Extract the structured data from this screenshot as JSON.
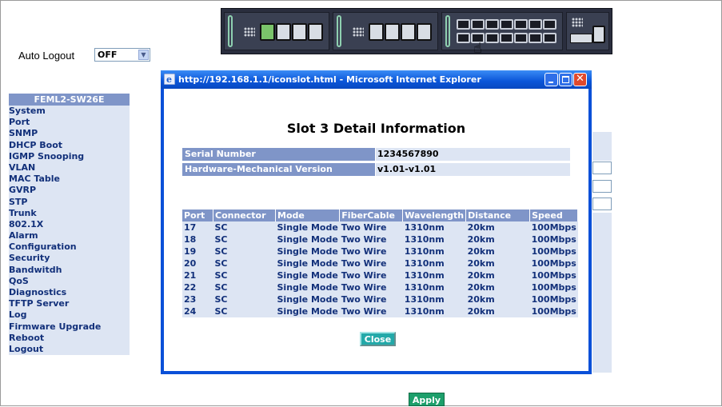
{
  "window": {
    "title": "http://192.168.1.1/iconslot.html - Microsoft Internet Explorer"
  },
  "auto_logout": {
    "label": "Auto Logout",
    "selected": "OFF"
  },
  "menu": {
    "title": "FEML2-SW26E",
    "items": [
      "System",
      "Port",
      "SNMP",
      "DHCP Boot",
      "IGMP Snooping",
      "VLAN",
      "MAC Table",
      "GVRP",
      "STP",
      "Trunk",
      "802.1X",
      "Alarm",
      "Configuration",
      "Security",
      "Bandwitdh",
      "QoS",
      "Diagnostics",
      "TFTP Server",
      "Log",
      "Firmware Upgrade",
      "Reboot",
      "Logout"
    ]
  },
  "popup": {
    "heading": "Slot 3 Detail Information",
    "serial_label": "Serial Number",
    "serial_value": "1234567890",
    "hw_label": "Hardware-Mechanical Version",
    "hw_value": "v1.01-v1.01",
    "table": {
      "headers": [
        "Port",
        "Connector",
        "Mode",
        "FiberCable",
        "Wavelength",
        "Distance",
        "Speed"
      ],
      "rows": [
        [
          "17",
          "SC",
          "Single Mode",
          "Two Wire",
          "1310nm",
          "20km",
          "100Mbps"
        ],
        [
          "18",
          "SC",
          "Single Mode",
          "Two Wire",
          "1310nm",
          "20km",
          "100Mbps"
        ],
        [
          "19",
          "SC",
          "Single Mode",
          "Two Wire",
          "1310nm",
          "20km",
          "100Mbps"
        ],
        [
          "20",
          "SC",
          "Single Mode",
          "Two Wire",
          "1310nm",
          "20km",
          "100Mbps"
        ],
        [
          "21",
          "SC",
          "Single Mode",
          "Two Wire",
          "1310nm",
          "20km",
          "100Mbps"
        ],
        [
          "22",
          "SC",
          "Single Mode",
          "Two Wire",
          "1310nm",
          "20km",
          "100Mbps"
        ],
        [
          "23",
          "SC",
          "Single Mode",
          "Two Wire",
          "1310nm",
          "20km",
          "100Mbps"
        ],
        [
          "24",
          "SC",
          "Single Mode",
          "Two Wire",
          "1310nm",
          "20km",
          "100Mbps"
        ]
      ]
    },
    "close_label": "Close"
  },
  "apply_label": "Apply",
  "icons": {
    "ie": "ie-icon",
    "minimize": "minimize-icon",
    "maximize": "maximize-icon",
    "close": "close-icon",
    "cursor": "hand-cursor-icon",
    "dropdown": "chevron-down-icon"
  },
  "colors": {
    "header_blue": "#7f95c8",
    "row_light": "#dde5f3",
    "menu_text": "#12307a",
    "apply_green": "#1d9f6b",
    "close_teal": "#23a9a9",
    "titlebar_blue": "#0a55d8"
  }
}
